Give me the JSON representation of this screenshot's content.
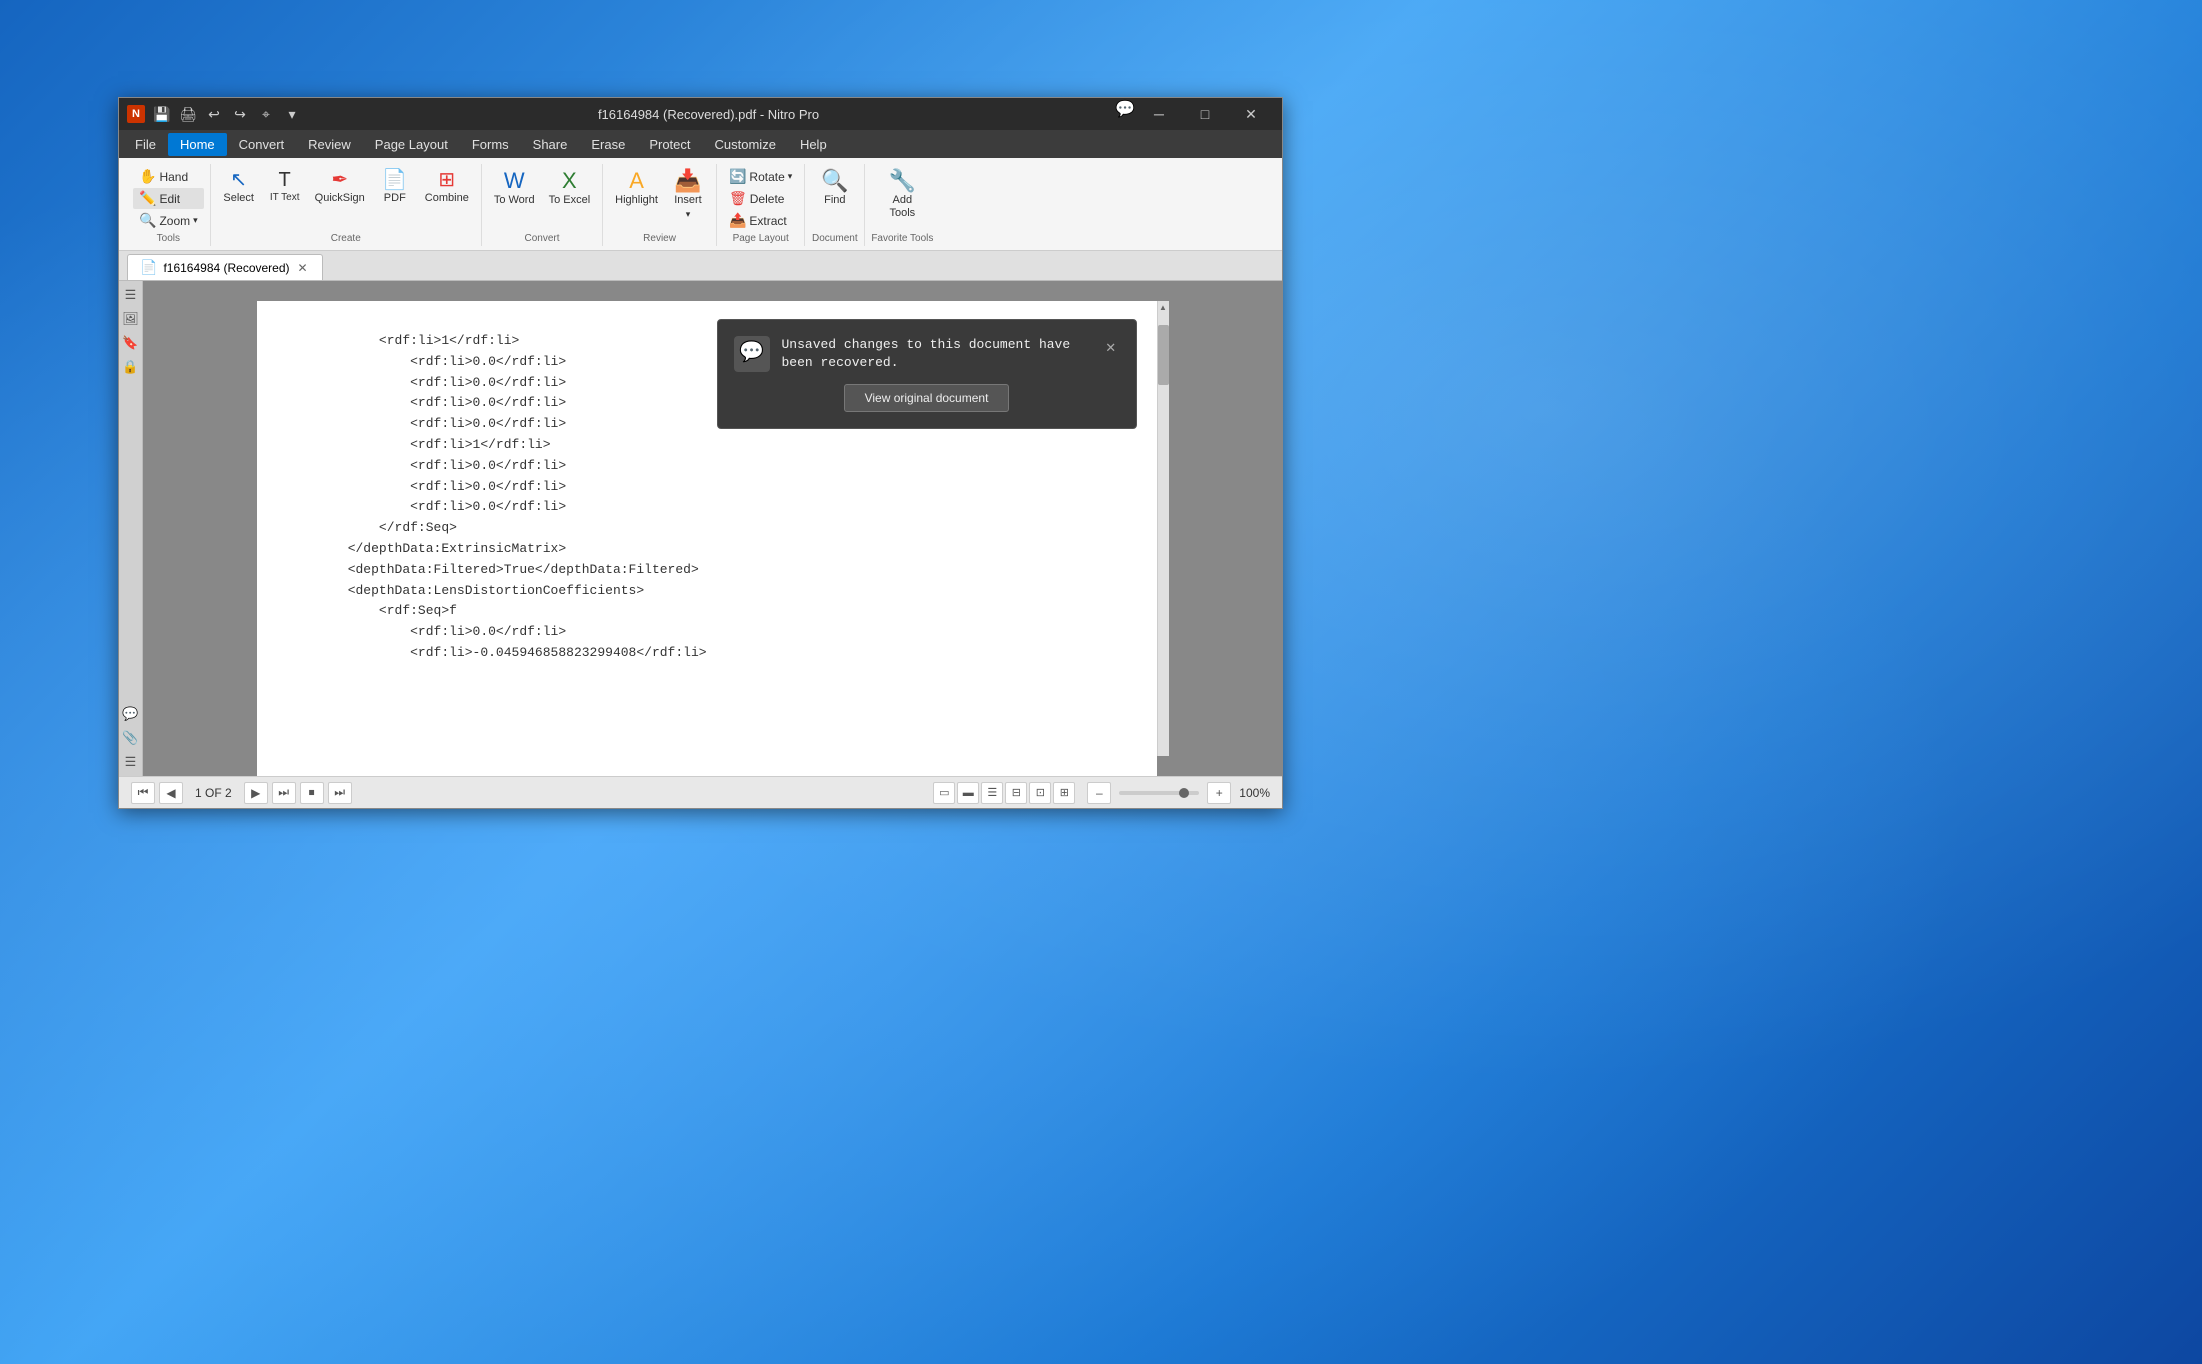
{
  "window": {
    "title": "f16164984 (Recovered).pdf - Nitro Pro",
    "app_icon": "N"
  },
  "title_bar": {
    "qat_buttons": [
      "save",
      "print",
      "undo",
      "redo",
      "cursor",
      "dropdown"
    ],
    "min_label": "─",
    "max_label": "□",
    "close_label": "✕"
  },
  "menu": {
    "items": [
      "File",
      "Home",
      "Convert",
      "Review",
      "Page Layout",
      "Forms",
      "Share",
      "Erase",
      "Protect",
      "Customize",
      "Help"
    ],
    "active": "Home"
  },
  "ribbon": {
    "tools_group": {
      "label": "Tools",
      "hand_label": "Hand",
      "edit_label": "Edit",
      "zoom_label": "Zoom"
    },
    "create_group": {
      "label": "Create",
      "select_label": "Select",
      "type_text_label": "Type Text",
      "quick_sign_label": "QuickSign",
      "pdf_label": "PDF",
      "combine_label": "Combine"
    },
    "convert_group": {
      "label": "Convert",
      "to_word_label": "To Word",
      "to_excel_label": "To Excel"
    },
    "review_group": {
      "label": "Review",
      "highlight_label": "Highlight",
      "insert_label": "Insert"
    },
    "page_layout_group": {
      "label": "Page Layout",
      "rotate_label": "Rotate",
      "delete_label": "Delete",
      "extract_label": "Extract"
    },
    "document_group": {
      "label": "Document",
      "find_label": "Find"
    },
    "favorite_tools_group": {
      "label": "Favorite Tools",
      "add_tools_label": "Add Tools"
    }
  },
  "tab": {
    "label": "f16164984 (Recovered)",
    "close": "✕"
  },
  "notification": {
    "text": "Unsaved changes to this document have been recovered.",
    "button_label": "View original document",
    "close": "✕"
  },
  "pdf_content": {
    "lines": [
      "        <rdf:li>1</rdf:li>",
      "            <rdf:li>0.0</rdf:li>",
      "            <rdf:li>0.0</rdf:li>",
      "            <rdf:li>0.0</rdf:li>",
      "            <rdf:li>0.0</rdf:li>",
      "            <rdf:li>1</rdf:li>",
      "            <rdf:li>0.0</rdf:li>",
      "            <rdf:li>0.0</rdf:li>",
      "            <rdf:li>0.0</rdf:li>",
      "        </rdf:Seq>",
      "    </depthData:ExtrinsicMatrix>",
      "    <depthData:Filtered>True</depthData:Filtered>",
      "    <depthData:LensDistortionCoefficients>",
      "        <rdf:Seq>f",
      "            <rdf:li>0.0</rdf:li>",
      "            <rdf:li>-0.045946858823299408</rdf:li>"
    ]
  },
  "status_bar": {
    "page_info": "1 OF 2",
    "zoom_level": "100%",
    "nav": {
      "first": "⏮",
      "prev": "◀",
      "play": "▶",
      "next": "⏭",
      "stop": "⏹",
      "last": "⏭"
    }
  }
}
